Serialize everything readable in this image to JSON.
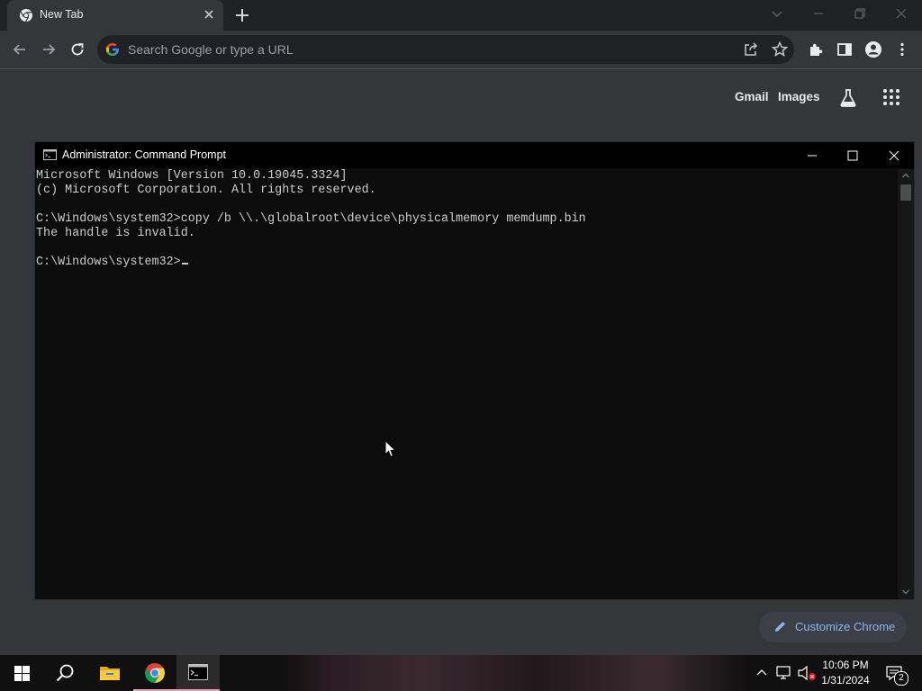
{
  "browser": {
    "tab": {
      "title": "New Tab"
    },
    "omnibox": {
      "placeholder": "Search Google or type a URL",
      "value": ""
    },
    "ntp": {
      "gmail": "Gmail",
      "images": "Images",
      "customize": "Customize Chrome"
    }
  },
  "cmd": {
    "title": "Administrator: Command Prompt",
    "lines": [
      "Microsoft Windows [Version 10.0.19045.3324]",
      "(c) Microsoft Corporation. All rights reserved.",
      "",
      "C:\\Windows\\system32>copy /b \\\\.\\globalroot\\device\\physicalmemory memdump.bin",
      "The handle is invalid.",
      "",
      "C:\\Windows\\system32>"
    ]
  },
  "taskbar": {
    "clock": {
      "time": "10:06 PM",
      "date": "1/31/2024"
    },
    "notification_count": "2"
  },
  "icons": {
    "tab": [
      "chrome-favicon-icon",
      "close-icon",
      "plus-icon"
    ],
    "toolbar": [
      "back-arrow-icon",
      "forward-arrow-icon",
      "reload-icon",
      "google-g-icon",
      "share-icon",
      "star-icon",
      "extensions-icon",
      "side-panel-icon",
      "profile-icon",
      "kebab-menu-icon"
    ],
    "taskbar": [
      "windows-start-icon",
      "search-icon",
      "file-explorer-icon",
      "chrome-icon",
      "command-prompt-icon"
    ]
  },
  "colors": {
    "chrome_dark": "#202124",
    "chrome_surface": "#35363a",
    "link_blue": "#8ab4f8",
    "console_bg": "#0c0c0c",
    "console_text": "#cccccc"
  }
}
